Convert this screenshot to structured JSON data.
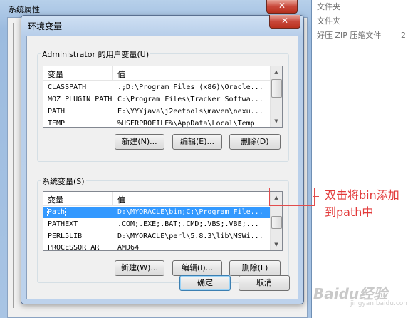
{
  "background_list": {
    "rows": [
      {
        "text": "文件夹",
        "extra": ""
      },
      {
        "text": "文件夹",
        "extra": ""
      },
      {
        "text": "好压 ZIP 压缩文件",
        "extra": "2"
      }
    ]
  },
  "outer_dialog": {
    "title": "系统属性",
    "close_glyph": "✕"
  },
  "dialog": {
    "title": "环境变量",
    "close_glyph": "✕",
    "user_vars": {
      "label": "Administrator 的用户变量(U)",
      "col_var": "变量",
      "col_val": "值",
      "rows": [
        {
          "name": "CLASSPATH",
          "value": ".;D:\\Program Files (x86)\\Oracle..."
        },
        {
          "name": "MOZ_PLUGIN_PATH",
          "value": "C:\\Program Files\\Tracker Softwa..."
        },
        {
          "name": "PATH",
          "value": "E:\\YYYjava\\j2eetools\\maven\\nexu..."
        },
        {
          "name": "TEMP",
          "value": "%USERPROFILE%\\AppData\\Local\\Temp"
        }
      ],
      "buttons": {
        "new": "新建(N)...",
        "edit": "编辑(E)...",
        "delete": "删除(D)"
      }
    },
    "system_vars": {
      "label": "系统变量(S)",
      "col_var": "变量",
      "col_val": "值",
      "rows": [
        {
          "name": "Path",
          "value": "D:\\MYORACLE\\bin;C:\\Program File...",
          "selected": true
        },
        {
          "name": "PATHEXT",
          "value": ".COM;.EXE;.BAT;.CMD;.VBS;.VBE;..."
        },
        {
          "name": "PERL5LIB",
          "value": "D:\\MYORACLE\\perl\\5.8.3\\lib\\MSWi..."
        },
        {
          "name": "PROCESSOR_AR",
          "value": "AMD64"
        }
      ],
      "buttons": {
        "new": "新建(W)...",
        "edit": "编辑(I)...",
        "delete": "删除(L)"
      }
    },
    "ok": "确定",
    "cancel": "取消"
  },
  "annotation": {
    "text": "双击将bin添加到path中",
    "color": "#e23a3a"
  },
  "watermark": {
    "main": "Baidu经验",
    "sub": "jingyan.baidu.com"
  },
  "colors": {
    "selection": "#3399ff",
    "title_bar": "#b6cde9",
    "close_button": "#c8473a"
  }
}
